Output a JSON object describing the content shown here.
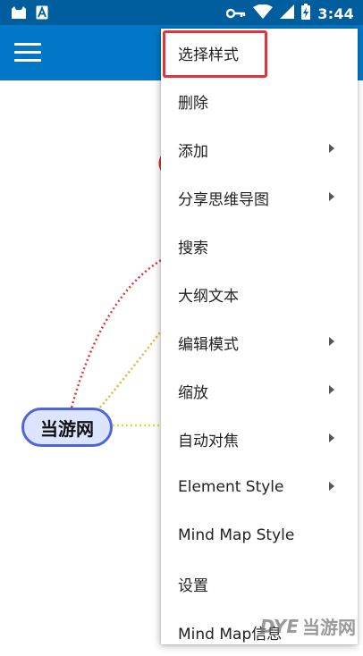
{
  "status_bar": {
    "time": "3:44",
    "left_icons": [
      "cat-notification-icon",
      "a-notification-icon"
    ],
    "right_icons": [
      "key-icon",
      "wifi-icon",
      "signal-icon",
      "battery-charging-icon"
    ]
  },
  "app_bar": {
    "color": "#0277c7",
    "menu_icon": "hamburger-icon"
  },
  "mind_map": {
    "central_node": "当游网",
    "node_border_color": "#5066d8",
    "branch_colors": [
      "#d43a3a",
      "#e8b23a",
      "#e8d93a"
    ]
  },
  "menu": {
    "items": [
      {
        "label": "选择样式",
        "has_submenu": false,
        "highlighted": true
      },
      {
        "label": "删除",
        "has_submenu": false
      },
      {
        "label": "添加",
        "has_submenu": true
      },
      {
        "label": "分享思维导图",
        "has_submenu": true
      },
      {
        "label": "搜索",
        "has_submenu": false
      },
      {
        "label": "大纲文本",
        "has_submenu": false
      },
      {
        "label": "编辑模式",
        "has_submenu": true
      },
      {
        "label": "缩放",
        "has_submenu": true
      },
      {
        "label": "自动对焦",
        "has_submenu": true
      },
      {
        "label": "Element Style",
        "has_submenu": true
      },
      {
        "label": "Mind Map Style",
        "has_submenu": false
      },
      {
        "label": "设置",
        "has_submenu": false
      },
      {
        "label": "Mind Map信息",
        "has_submenu": false
      }
    ],
    "highlight_color": "#d9393e"
  },
  "watermark": {
    "logo": "DYE",
    "text": "当游网"
  }
}
